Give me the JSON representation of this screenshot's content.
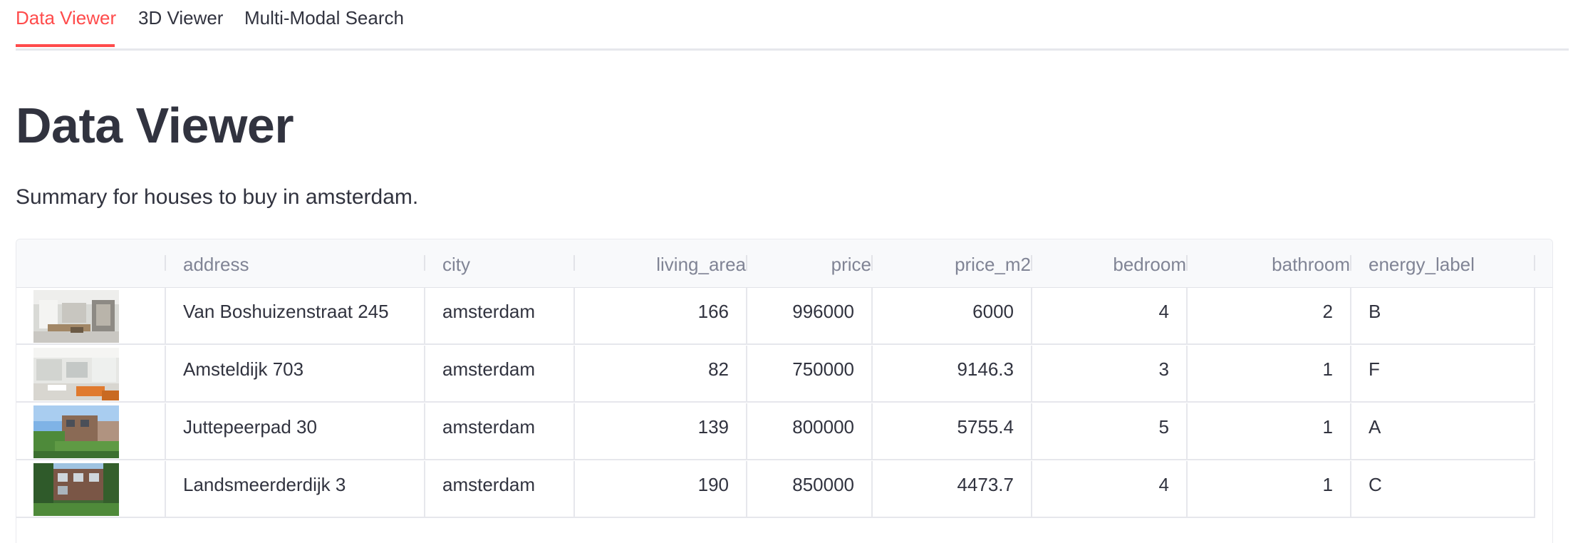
{
  "tabs": [
    {
      "label": "Data Viewer",
      "active": true
    },
    {
      "label": "3D Viewer",
      "active": false
    },
    {
      "label": "Multi-Modal Search",
      "active": false
    }
  ],
  "page": {
    "title": "Data Viewer",
    "summary": "Summary for houses to buy in amsterdam."
  },
  "table": {
    "columns": [
      "",
      "address",
      "city",
      "living_area",
      "price",
      "price_m2",
      "bedroom",
      "bathroom",
      "energy_label"
    ],
    "rows": [
      {
        "image": "living-room-photo",
        "address": "Van Boshuizenstraat 245",
        "city": "amsterdam",
        "living_area": "166",
        "price": "996000",
        "price_m2": "6000",
        "bedroom": "4",
        "bathroom": "2",
        "energy_label": "B"
      },
      {
        "image": "interior-photo",
        "address": "Amsteldijk 703",
        "city": "amsterdam",
        "living_area": "82",
        "price": "750000",
        "price_m2": "9146.3",
        "bedroom": "3",
        "bathroom": "1",
        "energy_label": "F"
      },
      {
        "image": "house-exterior-photo",
        "address": "Juttepeerpad 30",
        "city": "amsterdam",
        "living_area": "139",
        "price": "800000",
        "price_m2": "5755.4",
        "bedroom": "5",
        "bathroom": "1",
        "energy_label": "A"
      },
      {
        "image": "garden-house-photo",
        "address": "Landsmeerderdijk 3",
        "city": "amsterdam",
        "living_area": "190",
        "price": "850000",
        "price_m2": "4473.7",
        "bedroom": "4",
        "bathroom": "1",
        "energy_label": "C"
      }
    ]
  },
  "colors": {
    "accent": "#ff4b4b",
    "text": "#31333f",
    "header_text": "#808495",
    "header_bg": "#f8f9fb",
    "border": "#e6e7ec"
  }
}
